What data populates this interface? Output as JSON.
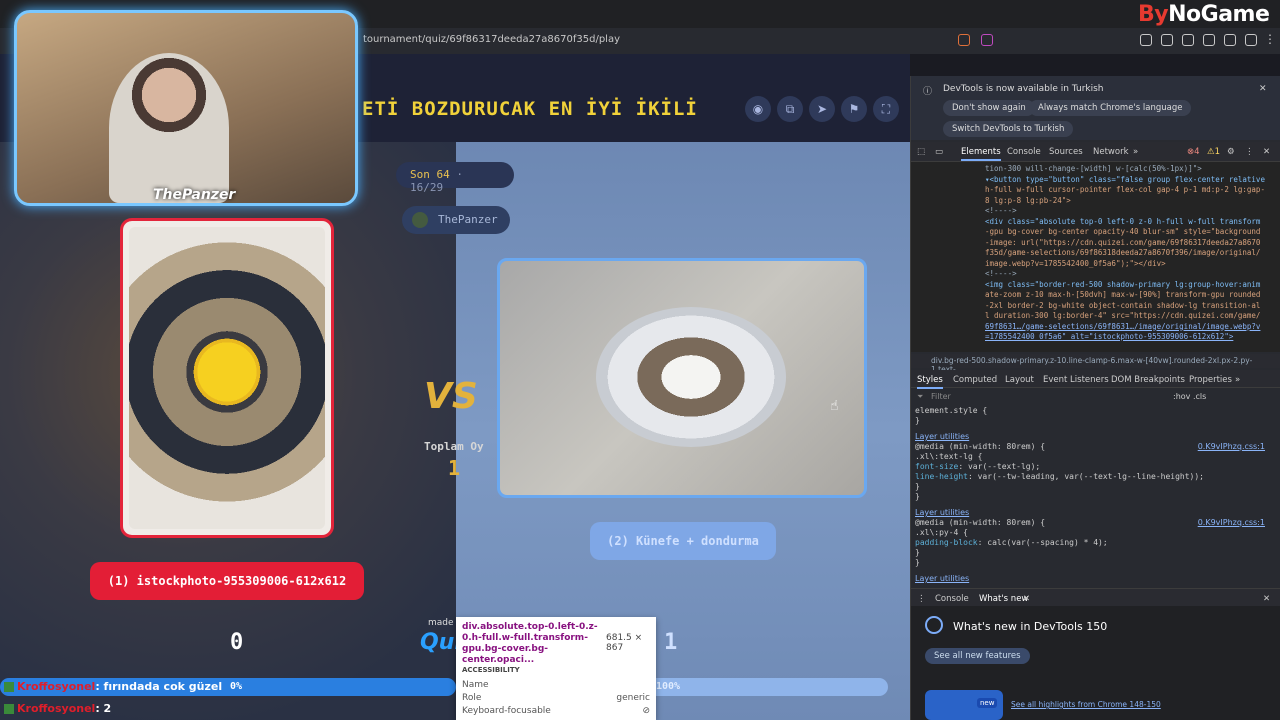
{
  "browser": {
    "url": "tournament/quiz/69f86317deeda27a8670f35d/play",
    "brand_prefix": "By",
    "brand_suffix": "NoGame"
  },
  "game": {
    "title": "ETİ BOZDURUCAK EN İYİ İKİLİ",
    "round_label": "Son 64",
    "round_sep": "·",
    "round_progress": "16/29",
    "player": "ThePanzer",
    "vs_label": "VS",
    "total_votes_label": "Toplam Oy",
    "total_votes": "1",
    "left_option": "(1) istockphoto-955309006-612x612",
    "right_option": "(2) Künefe + dondurma",
    "left_votes": "0",
    "right_votes": "1",
    "left_percent": "0%",
    "right_percent": "100%",
    "made_by": "made",
    "logo_text": "Qui"
  },
  "webcam": {
    "streamer": "ThePanzer"
  },
  "tooltip": {
    "selector": "div.absolute.top-0.left-0.z-0.h-full.w-full.transform-gpu.bg-cover.bg-center.opaci...",
    "size": "681.5 × 867",
    "section": "ACCESSIBILITY",
    "rows": [
      {
        "label": "Name",
        "value": ""
      },
      {
        "label": "Role",
        "value": "generic"
      },
      {
        "label": "Keyboard-focusable",
        "value": "⊘"
      }
    ]
  },
  "chat": [
    {
      "nick": "Kroffosyonel",
      "msg": ": fırındada cok güzel"
    },
    {
      "nick": "Kroffosyonel",
      "msg": ": 2"
    }
  ],
  "devtools": {
    "info": "DevTools is now available in Turkish",
    "btn_dont_show": "Don't show again",
    "btn_match": "Always match Chrome's language",
    "btn_switch": "Switch DevTools to Turkish",
    "tabs": [
      "Elements",
      "Console",
      "Sources",
      "Network"
    ],
    "errors": "4",
    "warnings": "1",
    "code": [
      "tion-300 will-change-[width] w-[calc(50%-1px)]\">",
      "▾<button type=\"button\" class=\"false group flex-center relative",
      "h-full w-full cursor-pointer flex-col gap-4 p-1 md:p-2 lg:gap-",
      "8 lg:p-8 lg:pb-24\">",
      "<!---->",
      "<div class=\"absolute top-0 left-0 z-0 h-full w-full transform",
      "-gpu bg-cover bg-center opacity-40 blur-sm\" style=\"background",
      "-image: url(\"https://cdn.quizei.com/game/69f86317deeda27a8670",
      "f35d/game-selections/69f86318deeda27a8670f396/image/original/",
      "image.webp?v=1785542400_0f5a6\");\"></div>",
      "<!---->",
      "<img class=\"border-red-500 shadow-primary lg:group-hover:anim",
      "ate-zoom z-10 max-h-[50dvh] max-w-[90%] transform-gpu rounded",
      "-2xl border-2 bg-white object-contain shadow-lg transition-al",
      "l duration-300 lg:border-4\" src=\"https://cdn.quizei.com/game/",
      "69f8631…/game-selections/69f8631…/image/original/image.webp?v",
      "=1785542400_0f5a6\" alt=\"istockphoto-955309006-612x612\">"
    ],
    "breadcrumb": "div.bg-red-500.shadow-primary.z-10.line-clamp-6.max-w-[40vw].rounded-2xl.px-2.py-1.text-",
    "subtabs": [
      "Styles",
      "Computed",
      "Layout",
      "Event Listeners",
      "DOM Breakpoints",
      "Properties"
    ],
    "filter": "Filter",
    "filter_tools": ":hov  .cls",
    "styles": [
      {
        "t": "element.style {"
      },
      {
        "t": "}"
      },
      {
        "t": ""
      },
      {
        "link": "Layer utilities"
      },
      {
        "t": "@media (min-width: 80rem) {",
        "file": "0.K9vIPhzq.css:1"
      },
      {
        "t": " .xl\\:text-lg {"
      },
      {
        "p": "   font-size",
        "v": ": var(--text-lg);"
      },
      {
        "p": "   line-height",
        "v": ": var(--tw-leading, var(--text-lg--line-height));"
      },
      {
        "t": " }"
      },
      {
        "t": "}"
      },
      {
        "link": "Layer utilities"
      },
      {
        "t": "@media (min-width: 80rem) {",
        "file": "0.K9vIPhzq.css:1"
      },
      {
        "t": " .xl\\:py-4 {"
      },
      {
        "p": "   padding-block",
        "v": ": calc(var(--spacing) * 4);"
      },
      {
        "t": " }"
      },
      {
        "t": "}"
      },
      {
        "link": "Layer utilities"
      }
    ],
    "drawer_tabs": [
      "Console",
      "What's new"
    ],
    "whatsnew_title": "What's new in DevTools 150",
    "whatsnew_btn": "See all new features",
    "whatsnew_new": "new",
    "whatsnew_link": "See all highlights from Chrome 148-150"
  }
}
